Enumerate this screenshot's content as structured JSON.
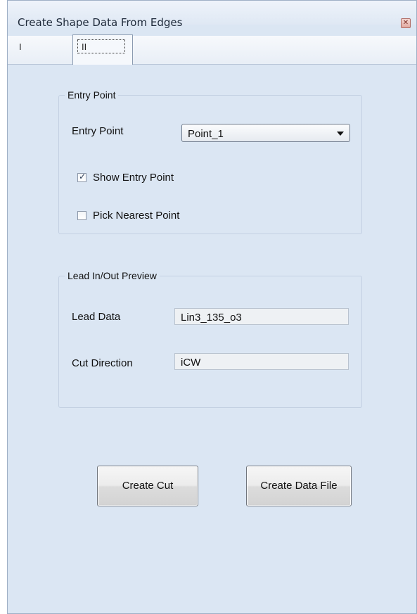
{
  "window": {
    "title": "Create Shape Data From Edges",
    "close_glyph": "✕"
  },
  "tabs": [
    {
      "label": "I",
      "active": false
    },
    {
      "label": "II",
      "active": true
    }
  ],
  "entry_group": {
    "legend": "Entry Point",
    "entry_point_label": "Entry Point",
    "entry_point_value": "Point_1",
    "show_entry_point": {
      "label": "Show Entry Point",
      "checked": true
    },
    "pick_nearest_point": {
      "label": "Pick Nearest Point",
      "checked": false
    }
  },
  "lead_group": {
    "legend": "Lead In/Out Preview",
    "lead_data_label": "Lead Data",
    "lead_data_value": "Lin3_135_o3",
    "cut_direction_label": "Cut Direction",
    "cut_direction_value": "iCW"
  },
  "buttons": {
    "create_cut": "Create Cut",
    "create_data_file": "Create Data File"
  },
  "colors": {
    "panel_background": "#dbe6f3",
    "group_border": "#c3d0e2"
  }
}
